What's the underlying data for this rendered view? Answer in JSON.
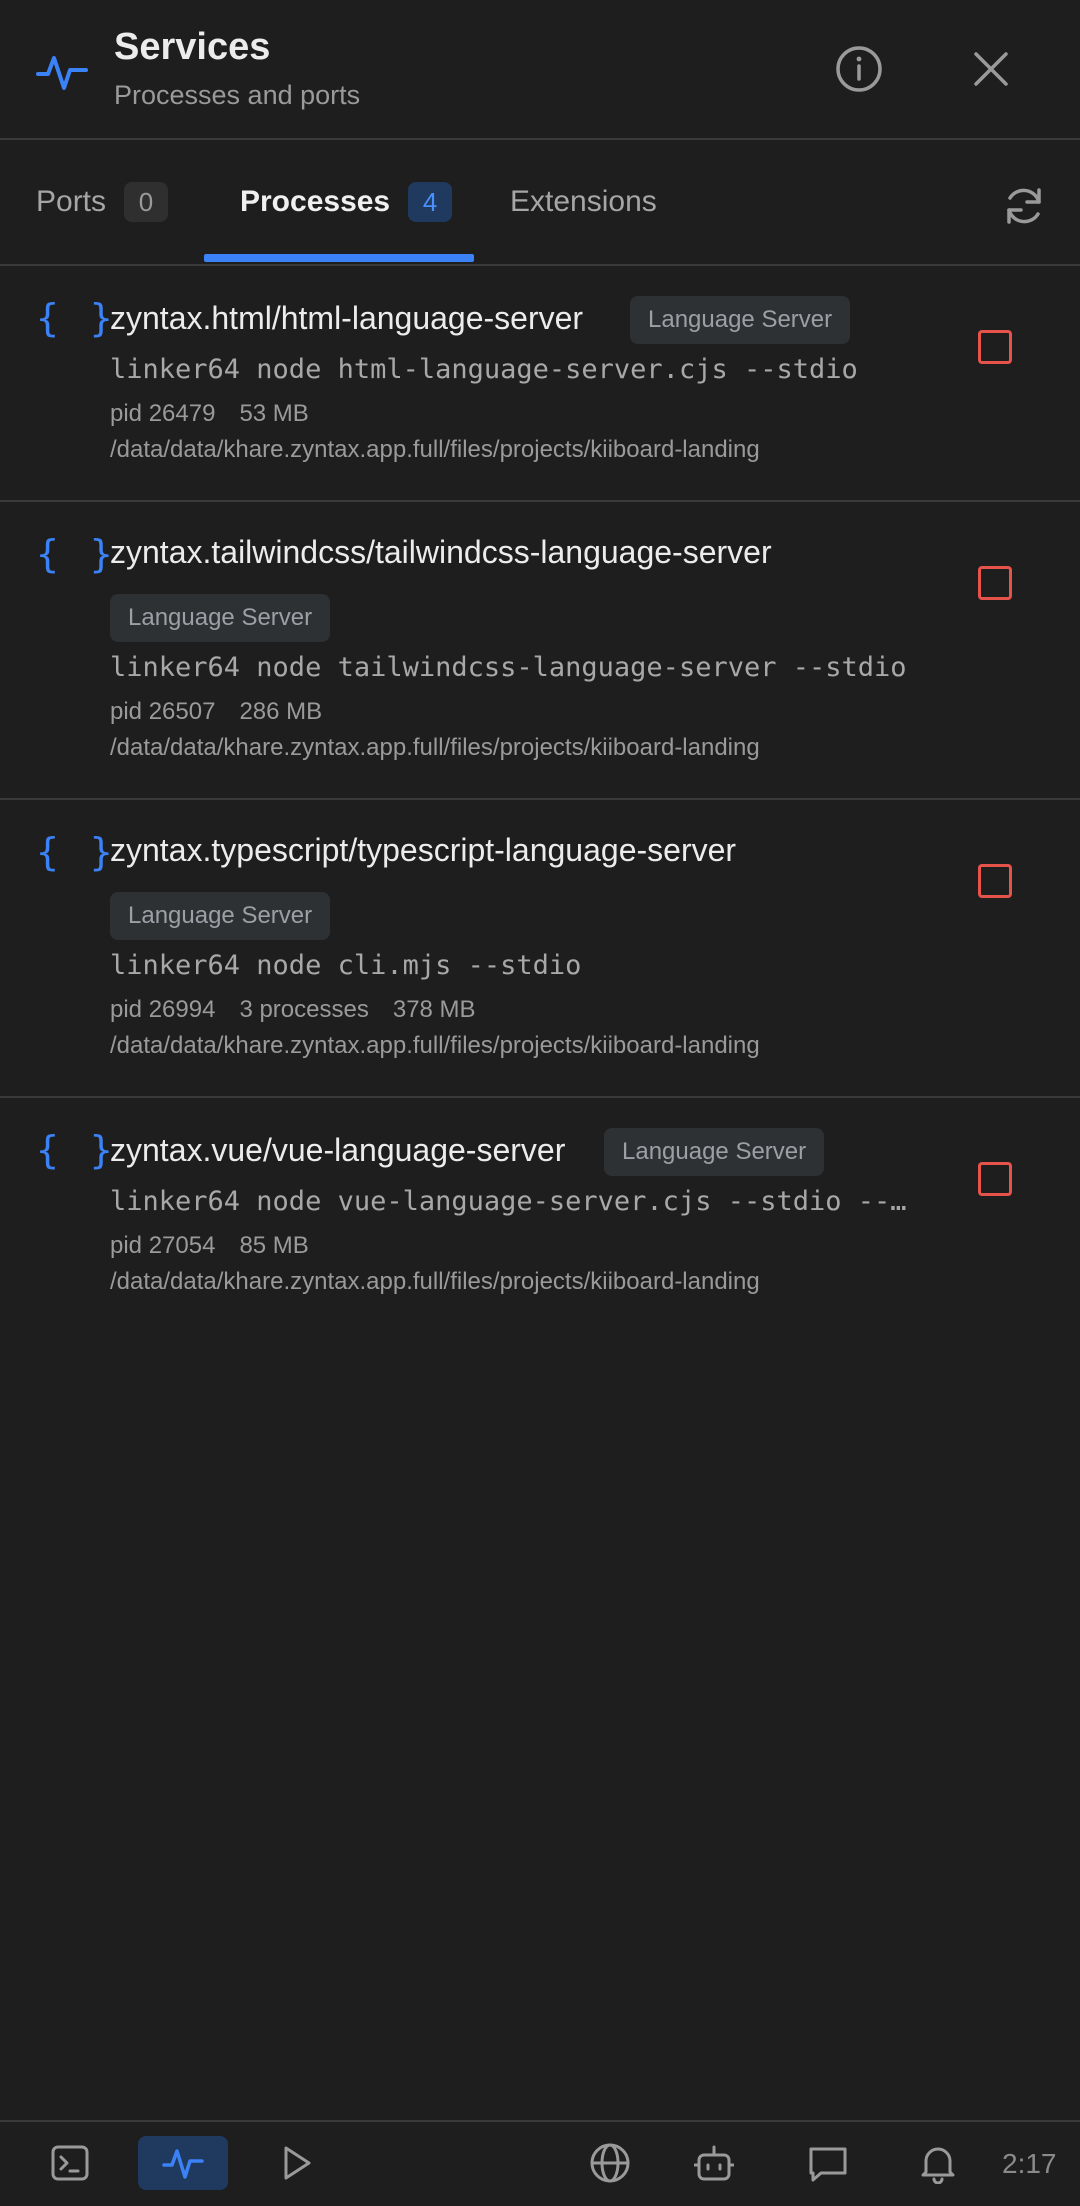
{
  "header": {
    "title": "Services",
    "subtitle": "Processes and ports",
    "icon": "activity-pulse-icon",
    "accent": "#3b82f6"
  },
  "tabs": [
    {
      "label": "Ports",
      "count": "0"
    },
    {
      "label": "Processes",
      "count": "4",
      "active": true
    },
    {
      "label": "Extensions"
    }
  ],
  "processes": [
    {
      "name": "zyntax.html/html-language-server",
      "badge": "Language Server",
      "command": "linker64 node html-language-server.cjs --stdio",
      "pid": "pid 26479",
      "memory": "53 MB",
      "path": "/data/data/khare.zyntax.app.full/files/projects/kiiboard-landing"
    },
    {
      "name": "zyntax.tailwindcss/tailwindcss-language-server",
      "badge": "Language Server",
      "command": "linker64 node tailwindcss-language-server --stdio",
      "pid": "pid 26507",
      "memory": "286 MB",
      "path": "/data/data/khare.zyntax.app.full/files/projects/kiiboard-landing"
    },
    {
      "name": "zyntax.typescript/typescript-language-server",
      "badge": "Language Server",
      "command": "linker64 node cli.mjs --stdio",
      "pid": "pid 26994",
      "processes": "3 processes",
      "memory": "378 MB",
      "path": "/data/data/khare.zyntax.app.full/files/projects/kiiboard-landing"
    },
    {
      "name": "zyntax.vue/vue-language-server",
      "badge": "Language Server",
      "command": "linker64 node vue-language-server.cjs --stdio --…",
      "pid": "pid 27054",
      "memory": "85 MB",
      "path": "/data/data/khare.zyntax.app.full/files/projects/kiiboard-landing"
    }
  ],
  "bottom_bar": {
    "items": [
      "terminal-icon",
      "activity-pulse-icon",
      "play-icon",
      "globe-icon",
      "robot-icon",
      "chat-icon",
      "bell-icon"
    ],
    "active": "activity-pulse-icon",
    "time": "2:17"
  },
  "colors": {
    "background": "#1e1e1e",
    "accent": "#3b82f6",
    "stop": "#e5534b"
  }
}
